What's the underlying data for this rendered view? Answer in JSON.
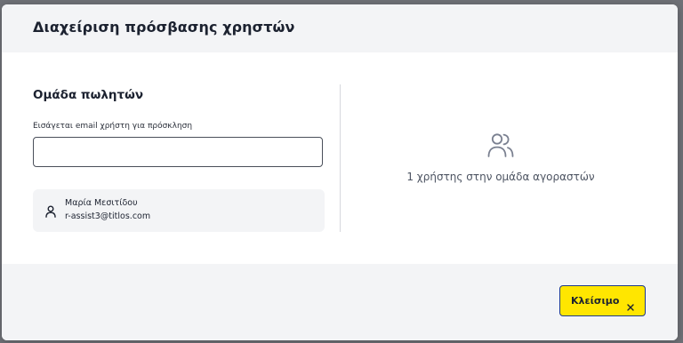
{
  "modal": {
    "title": "Διαχείριση πρόσβασης χρηστών"
  },
  "seller_group": {
    "title": "Ομάδα πωλητών",
    "invite_label": "Εισάγεται email χρήστη για πρόσκληση",
    "invite_value": "",
    "invite_placeholder": "",
    "members": [
      {
        "name": "Μαρία Μεσιτίδου",
        "email": "r-assist3@titlos.com",
        "icon": "person-icon"
      }
    ]
  },
  "buyer_group": {
    "icon": "users-icon",
    "count_text": "1 χρήστης στην ομάδα αγοραστών"
  },
  "footer": {
    "close_label": "Κλείσιμο",
    "close_icon": "close-icon"
  },
  "colors": {
    "accent_button": "#ffe600",
    "button_border": "#1e3a8a",
    "backdrop": "#6f7177",
    "panel_gray": "#f3f4f6"
  }
}
